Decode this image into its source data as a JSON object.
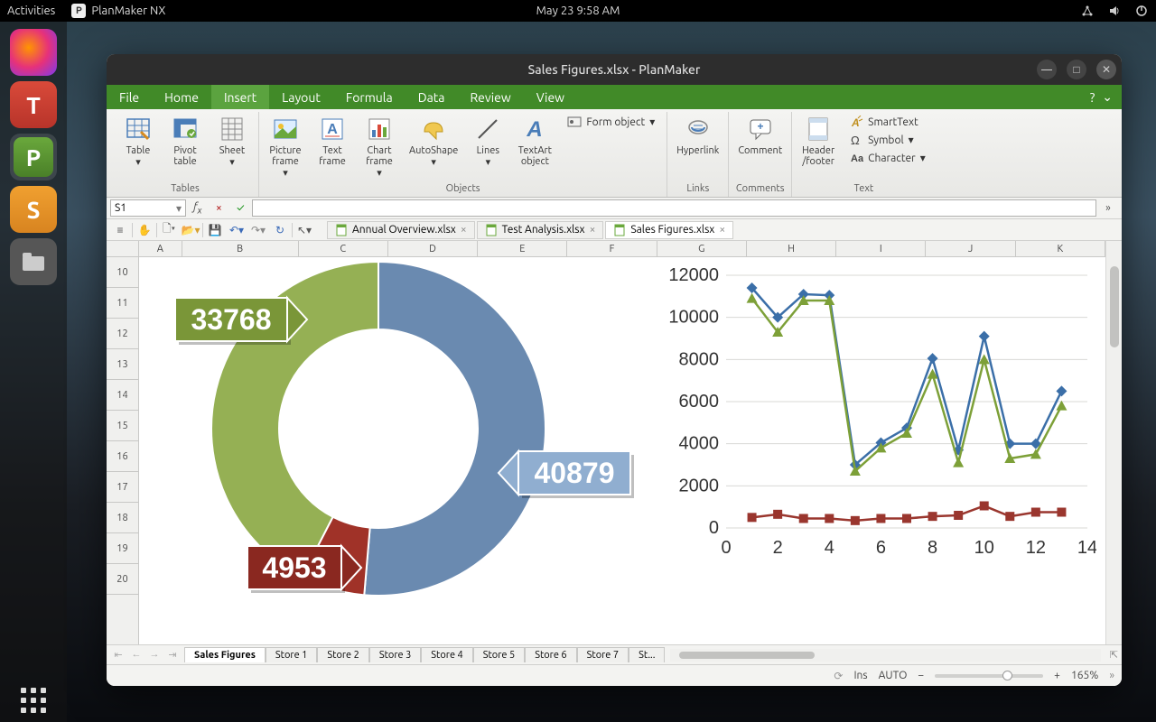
{
  "topbar": {
    "activities": "Activities",
    "app": "PlanMaker NX",
    "datetime": "May 23  9:58 AM"
  },
  "dock": {
    "firefox": "firefox",
    "textmaker": "T",
    "planmaker": "P",
    "presentations": "S",
    "files": "files"
  },
  "window": {
    "title": "Sales Figures.xlsx - PlanMaker"
  },
  "menubar": [
    "File",
    "Home",
    "Insert",
    "Layout",
    "Formula",
    "Data",
    "Review",
    "View"
  ],
  "ribbon": {
    "tables": {
      "label": "Tables",
      "items": {
        "table": "Table",
        "pivot": "Pivot\ntable",
        "sheet": "Sheet"
      }
    },
    "objects": {
      "label": "Objects",
      "items": {
        "pic": "Picture\nframe",
        "text": "Text\nframe",
        "chart": "Chart\nframe",
        "autoshape": "AutoShape",
        "lines": "Lines",
        "textart": "TextArt\nobject"
      },
      "formobj": "Form object"
    },
    "links": {
      "label": "Links",
      "hyperlink": "Hyperlink"
    },
    "comments": {
      "label": "Comments",
      "comment": "Comment"
    },
    "text": {
      "label": "Text",
      "header": "Header\n/footer",
      "smarttext": "SmartText",
      "symbol": "Symbol",
      "character": "Character"
    }
  },
  "cellref": "S1",
  "filetabs": [
    {
      "name": "Annual Overview.xlsx",
      "active": false
    },
    {
      "name": "Test Analysis.xlsx",
      "active": false
    },
    {
      "name": "Sales Figures.xlsx",
      "active": true
    }
  ],
  "columns": [
    "A",
    "B",
    "C",
    "D",
    "E",
    "F",
    "G",
    "H",
    "I",
    "J",
    "K"
  ],
  "rows": [
    "10",
    "11",
    "12",
    "13",
    "14",
    "15",
    "16",
    "17",
    "18",
    "19",
    "20"
  ],
  "sheettabs": [
    "Sales Figures",
    "Store 1",
    "Store 2",
    "Store 3",
    "Store 4",
    "Store 5",
    "Store 6",
    "Store 7",
    "St..."
  ],
  "status": {
    "ins": "Ins",
    "auto": "AUTO",
    "zoom": "165%"
  },
  "chart_data": [
    {
      "type": "pie",
      "subtype": "donut",
      "title": "",
      "series": [
        {
          "name": "Blue",
          "value": 40879,
          "color": "#6a8ab0",
          "label": "40879"
        },
        {
          "name": "Red",
          "value": 4953,
          "color": "#a03228",
          "label": "4953"
        },
        {
          "name": "Green",
          "value": 33768,
          "color": "#95b054",
          "label": "33768"
        }
      ]
    },
    {
      "type": "line",
      "title": "",
      "xlabel": "",
      "ylabel": "",
      "x": [
        1,
        2,
        3,
        4,
        5,
        6,
        7,
        8,
        9,
        10,
        11,
        12,
        13
      ],
      "xticks": [
        0,
        2,
        4,
        6,
        8,
        10,
        12,
        14
      ],
      "ylim": [
        0,
        12000
      ],
      "yticks": [
        0,
        2000,
        4000,
        6000,
        8000,
        10000,
        12000
      ],
      "series": [
        {
          "name": "Series1 (blue diamond)",
          "color": "#3b6fa8",
          "marker": "diamond",
          "values": [
            11400,
            10000,
            11100,
            11050,
            3000,
            4050,
            4750,
            8050,
            3700,
            9100,
            4000,
            4000,
            6500
          ]
        },
        {
          "name": "Series2 (green triangle)",
          "color": "#7da038",
          "marker": "triangle",
          "values": [
            10900,
            9300,
            10800,
            10800,
            2700,
            3800,
            4500,
            7300,
            3100,
            8000,
            3300,
            3500,
            5800
          ]
        },
        {
          "name": "Series3 (red square)",
          "color": "#9a362e",
          "marker": "square",
          "values": [
            500,
            650,
            450,
            450,
            350,
            450,
            450,
            550,
            600,
            1050,
            550,
            750,
            750
          ]
        }
      ]
    }
  ]
}
